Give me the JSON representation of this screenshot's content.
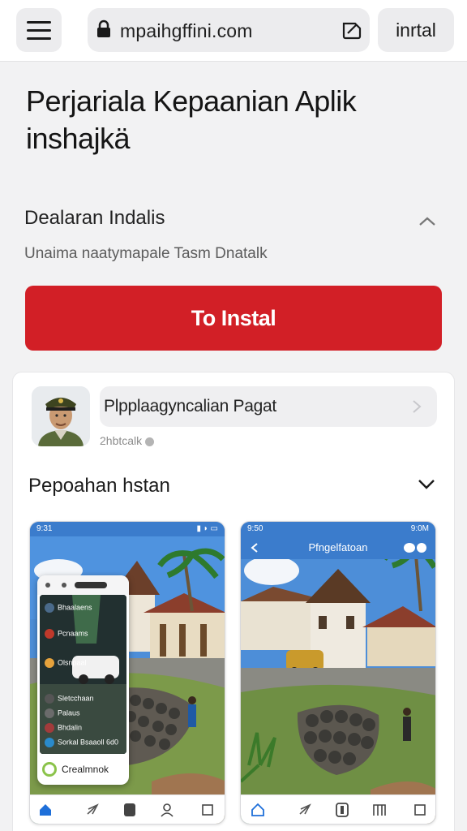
{
  "browser": {
    "url": "mpaihgffini.com",
    "install_label": "inrtal"
  },
  "page": {
    "title": "Perjariala Kepaanian  Aplik inshajkä",
    "subtitle": "Dealaran Indalis",
    "description": "Unaima naatymapale Tasm Dnatalk",
    "cta_label": "To Instal"
  },
  "card": {
    "app_name": "Plpplaagyncalian Pagat",
    "handle": "2hbtcalk",
    "section_title": "Pepoahan hstan"
  },
  "screenshots": {
    "left": {
      "status_time": "9:31",
      "overlay_items": [
        "Bhaalaens",
        "Pcnaams",
        "Olsnpaal",
        "Sletcchaan",
        "Palaus",
        "Bhdalin",
        "Sorkal",
        "Bsaaoll 6d0"
      ],
      "overlay_footer": "Crealmnok"
    },
    "right": {
      "status_time": "9:50",
      "status_right": "9:0M",
      "header_title": "Pfngelfatoan"
    }
  },
  "colors": {
    "accent": "#d21f26",
    "app_header": "#3b7ccc",
    "nav_active": "#1e6fd9"
  },
  "icons": {
    "menu": "hamburger-icon",
    "lock": "lock-icon",
    "share": "share-icon",
    "chevron": "chevron-right-icon",
    "collapse": "chevron-down-icon",
    "nav": [
      "home-icon",
      "send-icon",
      "bookmark-icon",
      "profile-icon",
      "square-icon"
    ]
  }
}
